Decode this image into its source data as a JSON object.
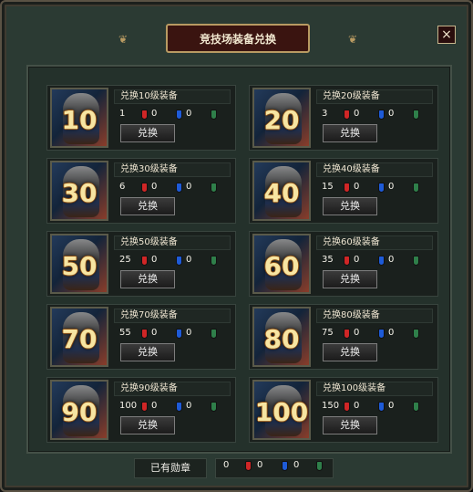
{
  "window": {
    "title": "竞技场装备兑换",
    "close_label": "×"
  },
  "exchange_button_label": "兑换",
  "cards": [
    {
      "level": "10",
      "label": "兑换10级装备",
      "cost": {
        "count": "1",
        "red": "0",
        "blue": "0"
      }
    },
    {
      "level": "20",
      "label": "兑换20级装备",
      "cost": {
        "count": "3",
        "red": "0",
        "blue": "0"
      }
    },
    {
      "level": "30",
      "label": "兑换30级装备",
      "cost": {
        "count": "6",
        "red": "0",
        "blue": "0"
      }
    },
    {
      "level": "40",
      "label": "兑换40级装备",
      "cost": {
        "count": "15",
        "red": "0",
        "blue": "0"
      }
    },
    {
      "level": "50",
      "label": "兑换50级装备",
      "cost": {
        "count": "25",
        "red": "0",
        "blue": "0"
      }
    },
    {
      "level": "60",
      "label": "兑换60级装备",
      "cost": {
        "count": "35",
        "red": "0",
        "blue": "0"
      }
    },
    {
      "level": "70",
      "label": "兑换70级装备",
      "cost": {
        "count": "55",
        "red": "0",
        "blue": "0"
      }
    },
    {
      "level": "80",
      "label": "兑换80级装备",
      "cost": {
        "count": "75",
        "red": "0",
        "blue": "0"
      }
    },
    {
      "level": "90",
      "label": "兑换90级装备",
      "cost": {
        "count": "100",
        "red": "0",
        "blue": "0"
      }
    },
    {
      "level": "100",
      "label": "兑换100级装备",
      "cost": {
        "count": "150",
        "red": "0",
        "blue": "0"
      }
    }
  ],
  "owned": {
    "label": "已有勋章",
    "count": "0",
    "red": "0",
    "blue": "0"
  },
  "colors": {
    "medal_red": "#d02626",
    "medal_blue": "#1e5bd8",
    "medal_green": "#2f7f4a"
  }
}
